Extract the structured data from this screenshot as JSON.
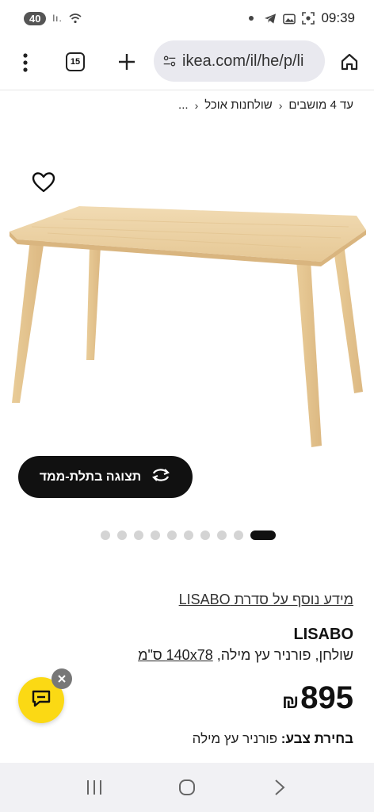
{
  "status_bar": {
    "badge": "40",
    "signal_text": "lı.",
    "time": "09:39",
    "icons": [
      "wifi-icon",
      "dot-icon",
      "telegram-icon",
      "gallery-icon",
      "screenshot-icon"
    ]
  },
  "browser": {
    "tab_count": "15",
    "url": "ikea.com/il/he/p/li",
    "icons": [
      "menu-dots-icon",
      "tabs-icon",
      "plus-icon",
      "site-settings-icon",
      "home-icon"
    ]
  },
  "breadcrumb": {
    "items": [
      "...",
      "שולחנות אוכל",
      "עד 4 מושבים"
    ]
  },
  "product_image": {
    "view_3d_label": "תצוגה בתלת-ממד",
    "carousel": {
      "total": 10,
      "active_index": 9
    }
  },
  "product": {
    "series_link": "מידע נוסף על סדרת LISABO",
    "name": "LISABO",
    "description_prefix": "שולחן, פורניר עץ מילה,",
    "size_link": "140x78 ס\"מ",
    "price_value": "895",
    "price_currency": "₪",
    "color_label": "בחירת צבע:",
    "color_value": "פורניר עץ מילה"
  },
  "colors": {
    "chat_yellow": "#fbd914",
    "dark": "#111111",
    "wood": "#eacfa2"
  }
}
